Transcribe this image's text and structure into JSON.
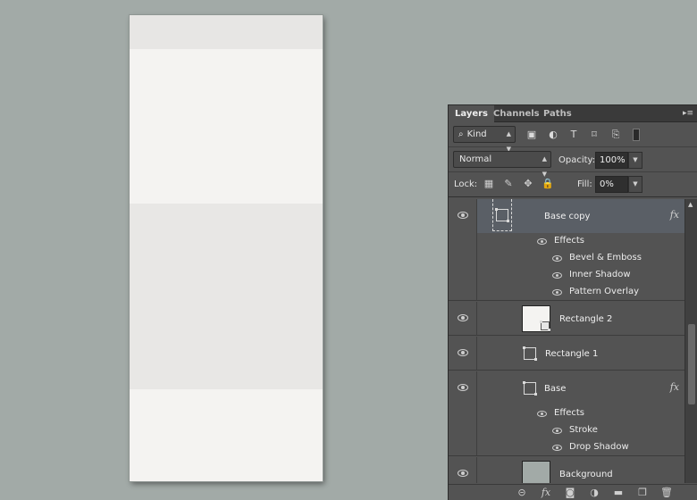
{
  "tabs": [
    {
      "label": "Layers",
      "active": true
    },
    {
      "label": "Channels",
      "active": false
    },
    {
      "label": "Paths",
      "active": false
    }
  ],
  "filter": {
    "kind_label": "Kind",
    "icons": [
      "image-filter-icon",
      "adjustment-filter-icon",
      "type-filter-icon",
      "shape-filter-icon",
      "smart-object-filter-icon",
      "filter-toggle-icon"
    ]
  },
  "blend": {
    "mode": "Normal",
    "opacity_label": "Opacity:",
    "opacity_value": "100%",
    "fill_label": "Fill:",
    "fill_value": "0%"
  },
  "lock": {
    "label": "Lock:",
    "icons": [
      "lock-transparent-icon",
      "lock-image-icon",
      "lock-position-icon",
      "lock-all-icon"
    ]
  },
  "layers": [
    {
      "name": "Base copy",
      "selected": true,
      "fx": "fx",
      "effects_label": "Effects",
      "effects": [
        "Bevel & Emboss",
        "Inner Shadow",
        "Pattern Overlay"
      ]
    },
    {
      "name": "Rectangle 2",
      "selected": false
    },
    {
      "name": "Rectangle 1",
      "selected": false
    },
    {
      "name": "Base",
      "selected": false,
      "fx": "fx",
      "effects_label": "Effects",
      "effects": [
        "Stroke",
        "Drop Shadow"
      ]
    },
    {
      "name": "Background",
      "selected": false
    }
  ],
  "footer_icons": [
    "link-layers-icon",
    "add-style-icon",
    "add-mask-icon",
    "new-adjustment-icon",
    "new-group-icon",
    "new-layer-icon",
    "delete-layer-icon"
  ],
  "colors": {
    "workspace": "#a2aaa7",
    "panel": "#535353",
    "selected_row": "#5a5f66"
  }
}
